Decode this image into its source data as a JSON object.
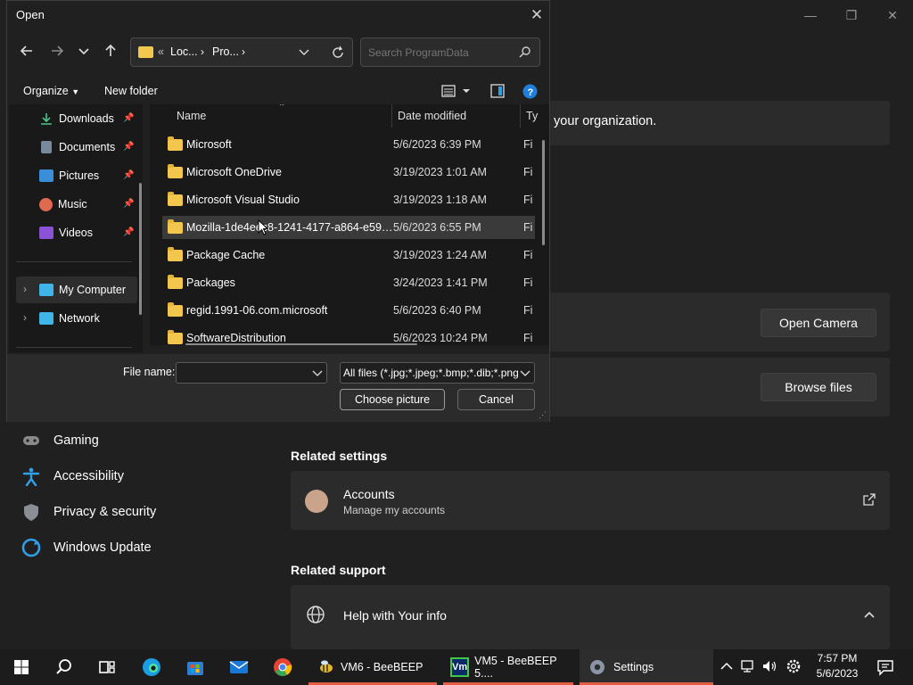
{
  "settings": {
    "banner_text": "your organization.",
    "open_camera_label": "Open Camera",
    "browse_files_label": "Browse files",
    "nav": [
      {
        "label": "Gaming",
        "icon": "gaming-icon"
      },
      {
        "label": "Accessibility",
        "icon": "accessibility-icon"
      },
      {
        "label": "Privacy & security",
        "icon": "shield-icon"
      },
      {
        "label": "Windows Update",
        "icon": "update-icon"
      }
    ],
    "related_settings_title": "Related settings",
    "accounts_title": "Accounts",
    "accounts_subtitle": "Manage my accounts",
    "related_support_title": "Related support",
    "help_title": "Help with Your info"
  },
  "dialog": {
    "title": "Open",
    "breadcrumb": {
      "prefix": "«",
      "parts": [
        "Loc...",
        "Pro..."
      ]
    },
    "search_placeholder": "Search ProgramData",
    "organize_label": "Organize",
    "new_folder_label": "New folder",
    "sidebar": [
      {
        "label": "Downloads",
        "icon": "downloads-icon",
        "pinned": true
      },
      {
        "label": "Documents",
        "icon": "documents-icon",
        "pinned": true
      },
      {
        "label": "Pictures",
        "icon": "pictures-icon",
        "pinned": true
      },
      {
        "label": "Music",
        "icon": "music-icon",
        "pinned": true
      },
      {
        "label": "Videos",
        "icon": "videos-icon",
        "pinned": true
      },
      {
        "label": "My Computer",
        "icon": "computer-icon",
        "pinned": false
      },
      {
        "label": "Network",
        "icon": "network-icon",
        "pinned": false
      }
    ],
    "columns": {
      "name": "Name",
      "date": "Date modified",
      "type": "Ty"
    },
    "files": [
      {
        "name": "Microsoft",
        "date": "5/6/2023 6:39 PM",
        "type": "Fi"
      },
      {
        "name": "Microsoft OneDrive",
        "date": "3/19/2023 1:01 AM",
        "type": "Fi"
      },
      {
        "name": "Microsoft Visual Studio",
        "date": "3/19/2023 1:18 AM",
        "type": "Fi"
      },
      {
        "name": "Mozilla-1de4eec8-1241-4177-a864-e594e...",
        "date": "5/6/2023 6:55 PM",
        "type": "Fi"
      },
      {
        "name": "Package Cache",
        "date": "3/19/2023 1:24 AM",
        "type": "Fi"
      },
      {
        "name": "Packages",
        "date": "3/24/2023 1:41 PM",
        "type": "Fi"
      },
      {
        "name": "regid.1991-06.com.microsoft",
        "date": "5/6/2023 6:40 PM",
        "type": "Fi"
      },
      {
        "name": "SoftwareDistribution",
        "date": "5/6/2023 10:24 PM",
        "type": "Fi"
      }
    ],
    "selected_index": 3,
    "file_name_label": "File name:",
    "file_name_value": "",
    "file_type_value": "All files (*.jpg;*.jpeg;*.bmp;*.dib;*.png",
    "choose_label": "Choose picture",
    "cancel_label": "Cancel"
  },
  "taskbar": {
    "apps": [
      {
        "label": "VM6 - BeeBEEP"
      },
      {
        "label": "VM5 - BeeBEEP 5...."
      },
      {
        "label": "Settings"
      }
    ],
    "time": "7:57 PM",
    "date": "5/6/2023"
  },
  "colors": {
    "accent": "#0067c0",
    "folder": "#f3c74e",
    "taskbar_indicator": "#e35d46"
  }
}
